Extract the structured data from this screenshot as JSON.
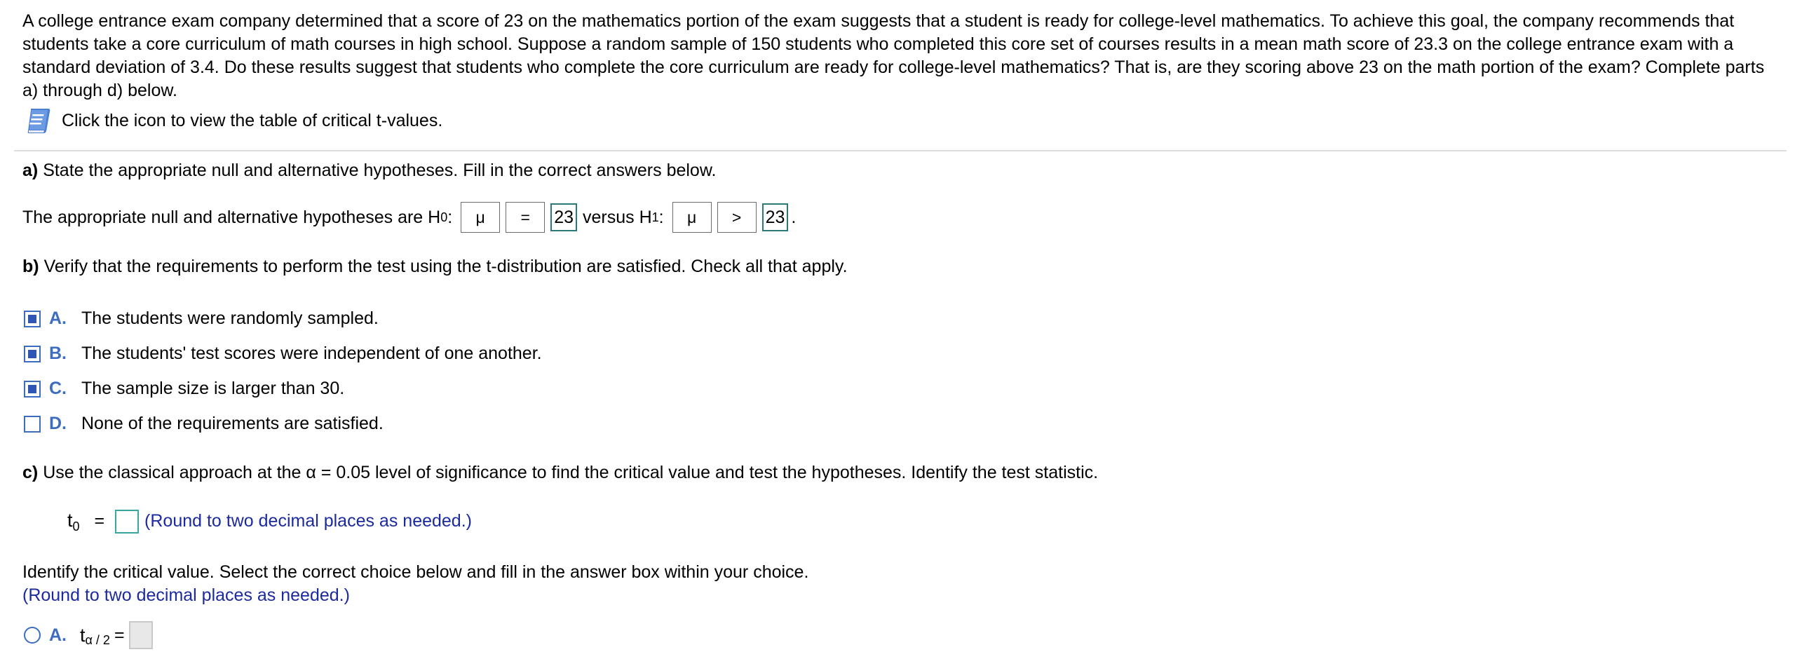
{
  "problem": {
    "intro": "A college entrance exam company determined that a score of 23 on the mathematics portion of the exam suggests that a student is ready for college-level mathematics. To achieve this goal, the company recommends that students take a core curriculum of math courses in high school. Suppose a random sample of 150 students who completed this core set of courses results in a mean math score of 23.3 on the college entrance exam with a standard deviation of 3.4. Do these results suggest that students who complete the core curriculum are ready for college-level mathematics? That is, are they scoring above 23 on the math portion of the exam? Complete parts a) through d) below.",
    "icon_text": "Click the icon to view the table of critical t-values.",
    "icon_name": "book-icon"
  },
  "part_a": {
    "label": "a)",
    "prompt": "State the appropriate null and alternative hypotheses. Fill in the correct answers below.",
    "hyp_prefix": "The appropriate null and alternative hypotheses are H",
    "h0_sub": "0",
    "colon": ":",
    "h0_param": "μ",
    "h0_op": "=",
    "h0_value": "23",
    "versus": "versus H",
    "h1_sub": "1",
    "h1_param": "μ",
    "h1_op": ">",
    "h1_value": "23",
    "period": "."
  },
  "part_b": {
    "label": "b)",
    "prompt": "Verify that the requirements to perform the test using the t-distribution are satisfied. Check all that apply.",
    "options": [
      {
        "letter": "A.",
        "text": "The students were randomly sampled.",
        "checked": true
      },
      {
        "letter": "B.",
        "text": "The students' test scores were independent of one another.",
        "checked": true
      },
      {
        "letter": "C.",
        "text": "The sample size is larger than 30.",
        "checked": true
      },
      {
        "letter": "D.",
        "text": "None of the requirements are satisfied.",
        "checked": false
      }
    ]
  },
  "part_c": {
    "label": "c)",
    "prompt_pre": "Use the classical approach at the",
    "alpha_expr": "α = 0.05",
    "prompt_post": "level of significance to find the critical value and test the hypotheses. Identify the test statistic.",
    "t0_symbol": "t",
    "t0_sub": "0",
    "equals": "=",
    "t0_value": "",
    "round_note": "(Round to two decimal places as needed.)",
    "crit_prompt": "Identify the critical value. Select the correct choice below and fill in the answer box within your choice.",
    "crit_round_note": "(Round to two decimal places as needed.)",
    "choice_a_letter": "A.",
    "choice_a_symbol": "t",
    "choice_a_sub": "α / 2",
    "choice_a_eq": "="
  },
  "colors": {
    "accent_blue": "#3d6dc0",
    "answer_border": "#2c7a78",
    "note_blue": "#1c2aa0"
  }
}
